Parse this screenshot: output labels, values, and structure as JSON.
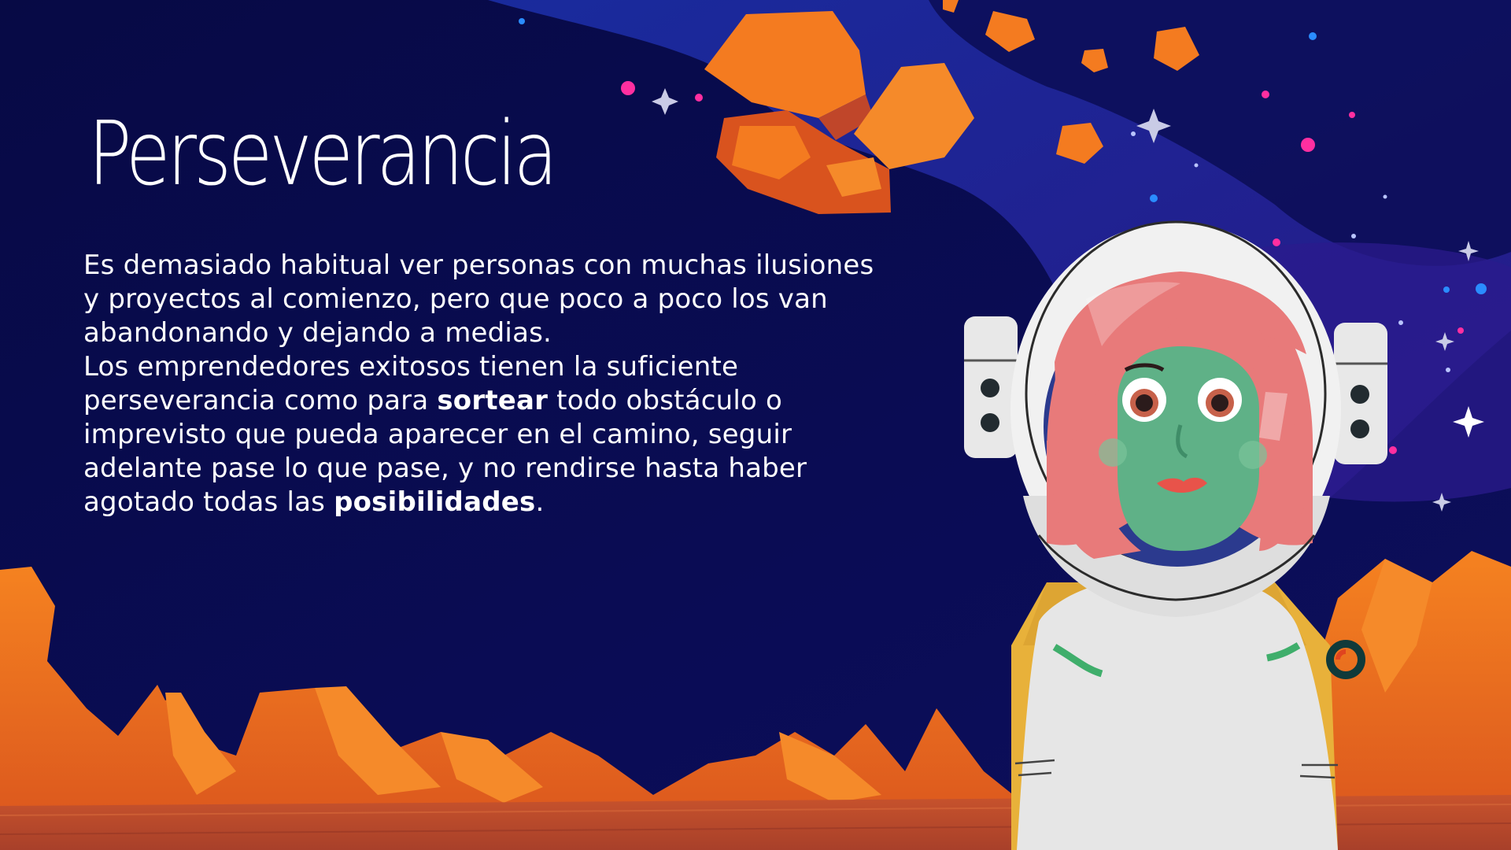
{
  "slide": {
    "title": "Perseverancia",
    "paragraph_1": "Es demasiado habitual ver personas con muchas ilusiones y proyectos al comienzo, pero que poco a poco los van abandonando y dejando a medias.",
    "paragraph_2": {
      "part_1": "Los emprendedores exitosos tienen la suficiente perseverancia como para ",
      "bold_1": "sortear",
      "part_2": " todo obstáculo o imprevisto que pueda aparecer en el camino, seguir adelante pase lo que pase, y no rendirse hasta haber agotado todas las ",
      "bold_2": "posibilidades",
      "part_3": "."
    }
  },
  "colors": {
    "sky": "#07083f",
    "nebula": "#1a2a9a",
    "rock_orange": "#f47b20",
    "ground": "#b9482a",
    "helmet": "#f2f2f2",
    "visor_hair": "#e87a7a",
    "face": "#5fb187",
    "backpack": "#e8b13a"
  }
}
